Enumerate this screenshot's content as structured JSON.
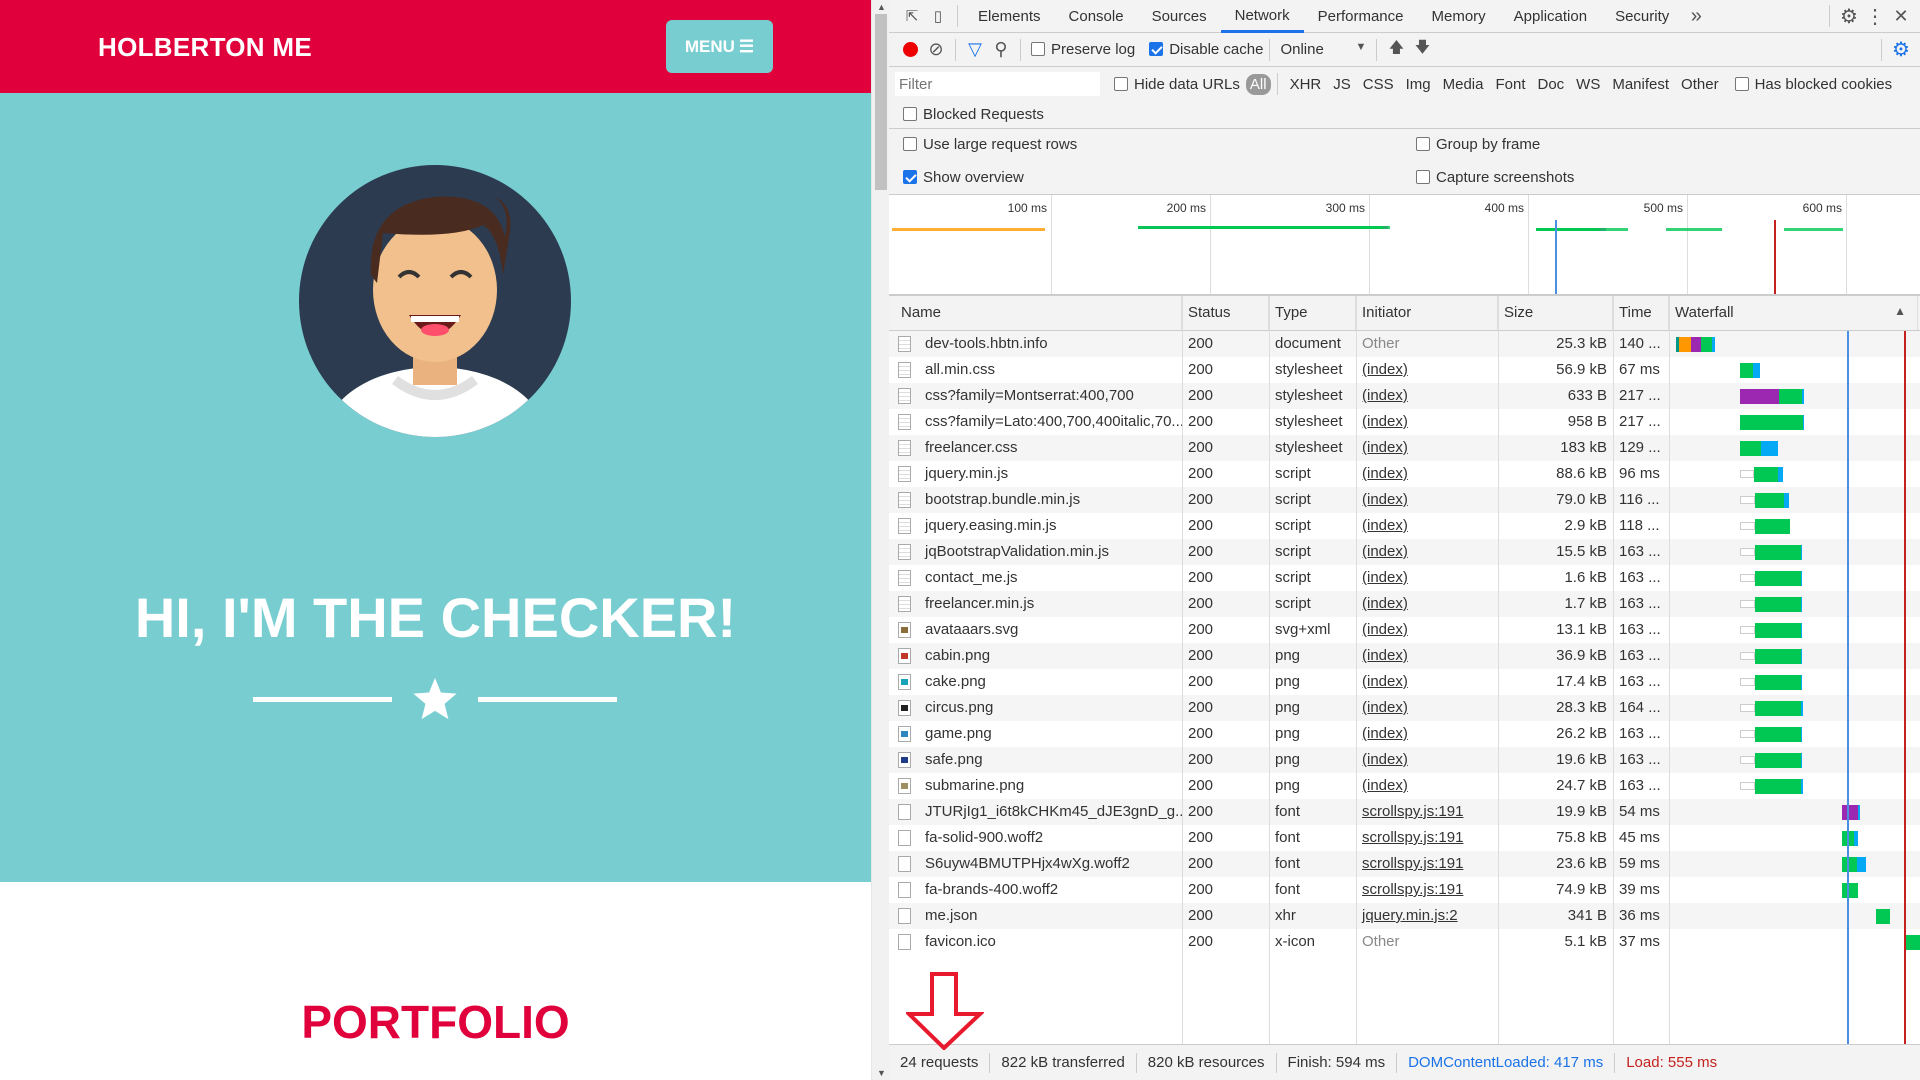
{
  "page": {
    "brand": "HOLBERTON ME",
    "menu": "MENU",
    "heading": "HI, I'M THE CHECKER!",
    "section": "PORTFOLIO",
    "colors": {
      "primary": "#e0003c",
      "hero": "#78cdd1"
    }
  },
  "devtools": {
    "tabs": [
      "Elements",
      "Console",
      "Sources",
      "Network",
      "Performance",
      "Memory",
      "Application",
      "Security"
    ],
    "active_tab": "Network",
    "toolbar": {
      "preserve_log": "Preserve log",
      "disable_cache": "Disable cache",
      "throttle": "Online"
    },
    "filter": {
      "placeholder": "Filter",
      "hide_data_urls": "Hide data URLs",
      "types": [
        "All",
        "XHR",
        "JS",
        "CSS",
        "Img",
        "Media",
        "Font",
        "Doc",
        "WS",
        "Manifest",
        "Other"
      ],
      "has_blocked": "Has blocked cookies",
      "blocked_requests": "Blocked Requests"
    },
    "settings": {
      "large_rows": "Use large request rows",
      "group_by_frame": "Group by frame",
      "show_overview": "Show overview",
      "capture_screenshots": "Capture screenshots"
    },
    "overview_ticks": [
      "100 ms",
      "200 ms",
      "300 ms",
      "400 ms",
      "500 ms",
      "600 ms"
    ],
    "columns": [
      "Name",
      "Status",
      "Type",
      "Initiator",
      "Size",
      "Time",
      "Waterfall"
    ],
    "markers": {
      "dom_content_loaded_ms": 417,
      "load_ms": 555
    },
    "rows": [
      {
        "name": "dev-tools.hbtn.info",
        "status": "200",
        "type": "document",
        "initiator": "Other",
        "size": "25.3 kB",
        "time": "140 ...",
        "icon": "doc",
        "wf": {
          "start": 0,
          "seg": [
            [
              "#009688",
              8
            ],
            [
              "#ff9800",
              28
            ],
            [
              "#9c27b0",
              24
            ],
            [
              "#00c853",
              27
            ],
            [
              "#03a9f4",
              9
            ]
          ]
        }
      },
      {
        "name": "all.min.css",
        "status": "200",
        "type": "stylesheet",
        "initiator": "(index)",
        "size": "56.9 kB",
        "time": "67 ms",
        "icon": "doc",
        "wf": {
          "start": 155,
          "seg": [
            [
              "#00c853",
              32
            ],
            [
              "#03a9f4",
              17
            ]
          ]
        }
      },
      {
        "name": "css?family=Montserrat:400,700",
        "status": "200",
        "type": "stylesheet",
        "initiator": "(index)",
        "size": "633 B",
        "time": "217 ...",
        "icon": "doc",
        "wf": {
          "start": 155,
          "seg": [
            [
              "#9c27b0",
              96
            ],
            [
              "#00c853",
              57
            ],
            [
              "#03a9f4",
              4
            ]
          ]
        }
      },
      {
        "name": "css?family=Lato:400,700,400italic,70...",
        "status": "200",
        "type": "stylesheet",
        "initiator": "(index)",
        "size": "958 B",
        "time": "217 ...",
        "icon": "doc",
        "wf": {
          "start": 155,
          "seg": [
            [
              "#00c853",
              154
            ],
            [
              "#03a9f4",
              4
            ]
          ]
        }
      },
      {
        "name": "freelancer.css",
        "status": "200",
        "type": "stylesheet",
        "initiator": "(index)",
        "size": "183 kB",
        "time": "129 ...",
        "icon": "doc",
        "wf": {
          "start": 155,
          "seg": [
            [
              "#00c853",
              53
            ],
            [
              "#03a9f4",
              40
            ]
          ]
        }
      },
      {
        "name": "jquery.min.js",
        "status": "200",
        "type": "script",
        "initiator": "(index)",
        "size": "88.6 kB",
        "time": "96 ms",
        "icon": "doc",
        "wf": {
          "start": 190,
          "seg": [
            [
              "#00c853",
              58
            ],
            [
              "#03a9f4",
              13
            ]
          ]
        }
      },
      {
        "name": "bootstrap.bundle.min.js",
        "status": "200",
        "type": "script",
        "initiator": "(index)",
        "size": "79.0 kB",
        "time": "116 ...",
        "icon": "doc",
        "wf": {
          "start": 193,
          "seg": [
            [
              "#00c853",
              71
            ],
            [
              "#03a9f4",
              11
            ]
          ]
        }
      },
      {
        "name": "jquery.easing.min.js",
        "status": "200",
        "type": "script",
        "initiator": "(index)",
        "size": "2.9 kB",
        "time": "118 ...",
        "icon": "doc",
        "wf": {
          "start": 193,
          "seg": [
            [
              "#00c853",
              84
            ]
          ]
        }
      },
      {
        "name": "jqBootstrapValidation.min.js",
        "status": "200",
        "type": "script",
        "initiator": "(index)",
        "size": "15.5 kB",
        "time": "163 ...",
        "icon": "doc",
        "wf": {
          "start": 193,
          "seg": [
            [
              "#00c853",
              112
            ],
            [
              "#03a9f4",
              3
            ]
          ]
        }
      },
      {
        "name": "contact_me.js",
        "status": "200",
        "type": "script",
        "initiator": "(index)",
        "size": "1.6 kB",
        "time": "163 ...",
        "icon": "doc",
        "wf": {
          "start": 193,
          "seg": [
            [
              "#00c853",
              112
            ],
            [
              "#03a9f4",
              3
            ]
          ]
        }
      },
      {
        "name": "freelancer.min.js",
        "status": "200",
        "type": "script",
        "initiator": "(index)",
        "size": "1.7 kB",
        "time": "163 ...",
        "icon": "doc",
        "wf": {
          "start": 193,
          "seg": [
            [
              "#00c853",
              112
            ],
            [
              "#03a9f4",
              3
            ]
          ]
        }
      },
      {
        "name": "avataaars.svg",
        "status": "200",
        "type": "svg+xml",
        "initiator": "(index)",
        "size": "13.1 kB",
        "time": "163 ...",
        "icon": "#8a6d3b",
        "wf": {
          "start": 193,
          "seg": [
            [
              "#00c853",
              112
            ],
            [
              "#03a9f4",
              3
            ]
          ]
        }
      },
      {
        "name": "cabin.png",
        "status": "200",
        "type": "png",
        "initiator": "(index)",
        "size": "36.9 kB",
        "time": "163 ...",
        "icon": "#c0392b",
        "wf": {
          "start": 193,
          "seg": [
            [
              "#00c853",
              112
            ],
            [
              "#03a9f4",
              3
            ]
          ]
        }
      },
      {
        "name": "cake.png",
        "status": "200",
        "type": "png",
        "initiator": "(index)",
        "size": "17.4 kB",
        "time": "163 ...",
        "icon": "#16a2b8",
        "wf": {
          "start": 193,
          "seg": [
            [
              "#00c853",
              112
            ],
            [
              "#03a9f4",
              3
            ]
          ]
        }
      },
      {
        "name": "circus.png",
        "status": "200",
        "type": "png",
        "initiator": "(index)",
        "size": "28.3 kB",
        "time": "164 ...",
        "icon": "#222222",
        "wf": {
          "start": 193,
          "seg": [
            [
              "#00c853",
              113
            ],
            [
              "#03a9f4",
              3
            ]
          ]
        }
      },
      {
        "name": "game.png",
        "status": "200",
        "type": "png",
        "initiator": "(index)",
        "size": "26.2 kB",
        "time": "163 ...",
        "icon": "#2e86c1",
        "wf": {
          "start": 193,
          "seg": [
            [
              "#00c853",
              112
            ],
            [
              "#03a9f4",
              3
            ]
          ]
        }
      },
      {
        "name": "safe.png",
        "status": "200",
        "type": "png",
        "initiator": "(index)",
        "size": "19.6 kB",
        "time": "163 ...",
        "icon": "#1f3c88",
        "wf": {
          "start": 193,
          "seg": [
            [
              "#00c853",
              112
            ],
            [
              "#03a9f4",
              3
            ]
          ]
        }
      },
      {
        "name": "submarine.png",
        "status": "200",
        "type": "png",
        "initiator": "(index)",
        "size": "24.7 kB",
        "time": "163 ...",
        "icon": "#9e8f60",
        "wf": {
          "start": 193,
          "seg": [
            [
              "#00c853",
              113
            ],
            [
              "#03a9f4",
              3
            ]
          ]
        }
      },
      {
        "name": "JTURjIg1_i6t8kCHKm45_dJE3gnD_g....",
        "status": "200",
        "type": "font",
        "initiator": "scrollspy.js:191",
        "size": "19.9 kB",
        "time": "54 ms",
        "icon": "blank",
        "wf": {
          "start": 405,
          "seg": [
            [
              "#9c27b0",
              38
            ],
            [
              "#03a9f4",
              6
            ]
          ]
        }
      },
      {
        "name": "fa-solid-900.woff2",
        "status": "200",
        "type": "font",
        "initiator": "scrollspy.js:191",
        "size": "75.8 kB",
        "time": "45 ms",
        "icon": "blank",
        "wf": {
          "start": 405,
          "seg": [
            [
              "#00c853",
              28
            ],
            [
              "#03a9f4",
              12
            ]
          ]
        }
      },
      {
        "name": "S6uyw4BMUTPHjx4wXg.woff2",
        "status": "200",
        "type": "font",
        "initiator": "scrollspy.js:191",
        "size": "23.6 kB",
        "time": "59 ms",
        "icon": "blank",
        "wf": {
          "start": 405,
          "seg": [
            [
              "#00c853",
              36
            ],
            [
              "#03a9f4",
              22
            ]
          ]
        }
      },
      {
        "name": "fa-brands-400.woff2",
        "status": "200",
        "type": "font",
        "initiator": "scrollspy.js:191",
        "size": "74.9 kB",
        "time": "39 ms",
        "icon": "blank",
        "wf": {
          "start": 405,
          "seg": [
            [
              "#00c853",
              38
            ]
          ]
        }
      },
      {
        "name": "me.json",
        "status": "200",
        "type": "xhr",
        "initiator": "jquery.min.js:2",
        "size": "341 B",
        "time": "36 ms",
        "icon": "blank",
        "wf": {
          "start": 487,
          "seg": [
            [
              "#00c853",
              35
            ]
          ]
        }
      },
      {
        "name": "favicon.ico",
        "status": "200",
        "type": "x-icon",
        "initiator": "Other",
        "size": "5.1 kB",
        "time": "37 ms",
        "icon": "blank",
        "wf": {
          "start": 561,
          "seg": [
            [
              "#00c853",
              37
            ]
          ]
        }
      }
    ],
    "status": {
      "requests": "24 requests",
      "transferred": "822 kB transferred",
      "resources": "820 kB resources",
      "finish": "Finish: 594 ms",
      "dcl": "DOMContentLoaded: 417 ms",
      "load": "Load: 555 ms"
    }
  }
}
